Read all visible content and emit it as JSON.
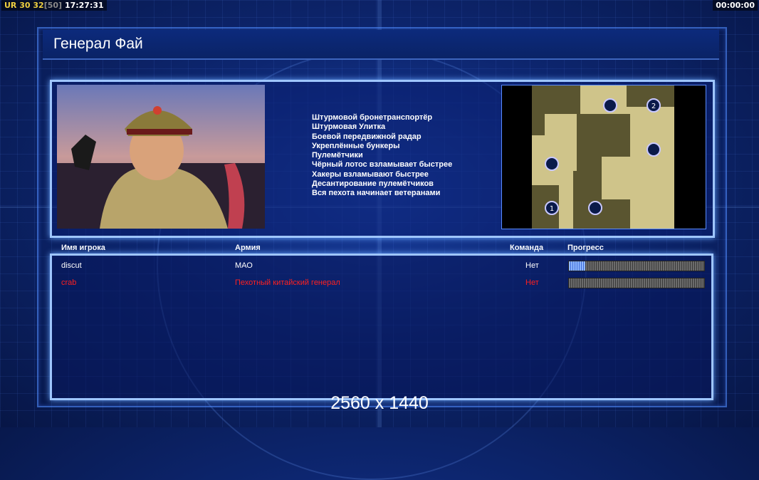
{
  "hud": {
    "left": {
      "prefix": "UR",
      "a": "30",
      "b": "32",
      "bracket": "[50]",
      "time": "17:27:31"
    },
    "right": {
      "time": "00:00:00"
    }
  },
  "screen": {
    "title": "Генерал Фай",
    "bonuses": [
      "Штурмовой бронетранспортёр",
      "Штурмовая Улитка",
      "Боевой передвижной радар",
      "Укреплённые бункеры",
      "Пулемётчики",
      "Чёрный лотос взламывает быстрее",
      "Хакеры взламывают быстрее",
      "Десантирование пулемётчиков",
      "Вся пехота начинает ветеранами"
    ],
    "map_slots": [
      "2",
      "1"
    ]
  },
  "table": {
    "headers": {
      "player": "Имя игрока",
      "army": "Армия",
      "team": "Команда",
      "progress": "Прогресс"
    },
    "rows": [
      {
        "player": "discut",
        "army": "МАО",
        "team": "Нет",
        "progress": 0.12,
        "color": "#ffffff"
      },
      {
        "player": "crab",
        "army": "Пехотный китайский генерал",
        "team": "Нет",
        "progress": 0.0,
        "color": "#ff2020"
      }
    ]
  },
  "resolution": "2560 x 1440",
  "colors": {
    "accent": "#9fc6ff",
    "bg": "#0d2670",
    "enemy": "#ff2020"
  }
}
